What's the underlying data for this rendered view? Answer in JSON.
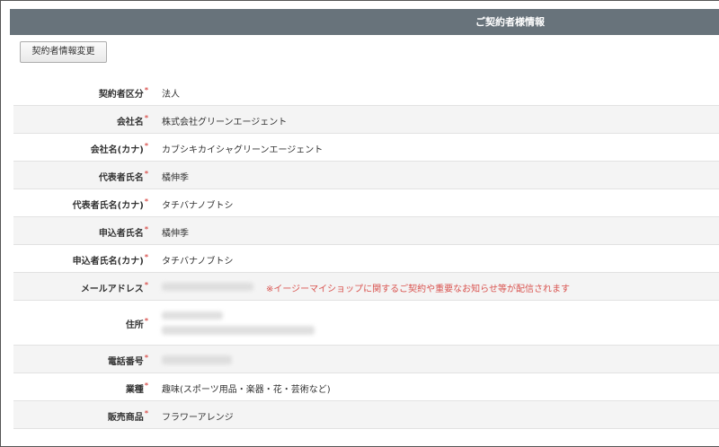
{
  "header": {
    "title": "ご契約者様情報"
  },
  "change_button": {
    "label": "契約者情報変更"
  },
  "required_mark": "*",
  "fields": [
    {
      "label": "契約者区分",
      "value": "法人"
    },
    {
      "label": "会社名",
      "value": "株式会社グリーンエージェント"
    },
    {
      "label": "会社名(カナ)",
      "value": "カブシキカイシャグリーンエージェント"
    },
    {
      "label": "代表者氏名",
      "value": "橘伸季"
    },
    {
      "label": "代表者氏名(カナ)",
      "value": "タチバナノブトシ"
    },
    {
      "label": "申込者氏名",
      "value": "橘伸季"
    },
    {
      "label": "申込者氏名(カナ)",
      "value": "タチバナノブトシ"
    },
    {
      "label": "メールアドレス",
      "value": "",
      "note": "※イージーマイショップに関するご契約や重要なお知らせ等が配信されます"
    },
    {
      "label": "住所",
      "value": ""
    },
    {
      "label": "電話番号",
      "value": ""
    },
    {
      "label": "業種",
      "value": "趣味(スポーツ用品・楽器・花・芸術など)"
    },
    {
      "label": "販売商品",
      "value": "フラワーアレンジ"
    }
  ]
}
